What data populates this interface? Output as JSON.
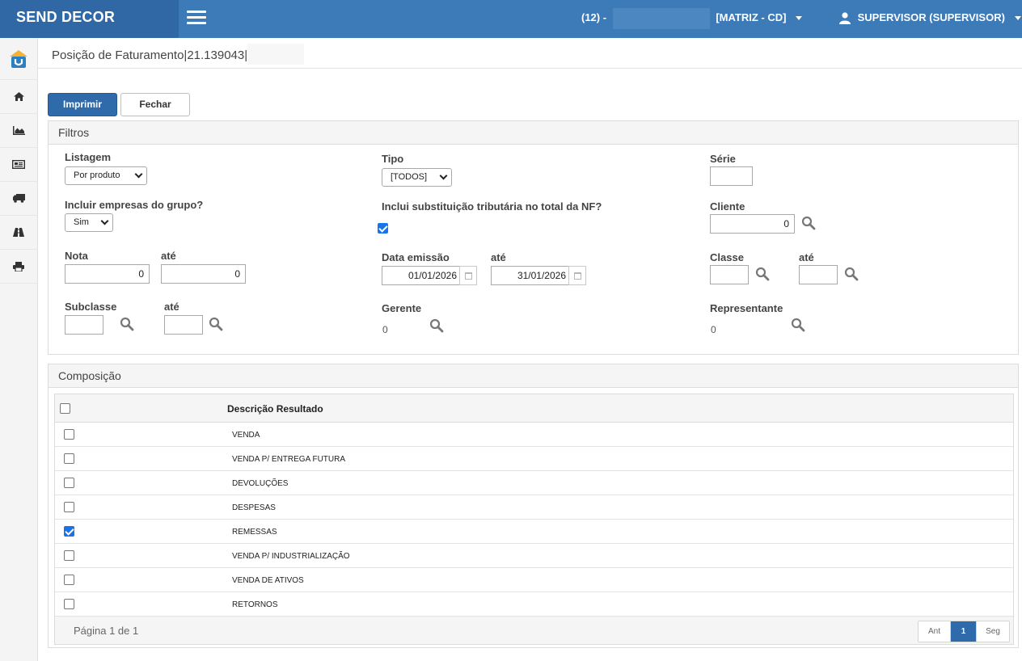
{
  "app": {
    "brand": "SEND DECOR"
  },
  "header": {
    "company_code": "(12) -",
    "company_branch": "[MATRIZ - CD]",
    "user": "SUPERVISOR (SUPERVISOR)"
  },
  "sidebar": {
    "items": [
      "home-icon",
      "area-chart-icon",
      "newspaper-icon",
      "truck-icon",
      "road-icon",
      "print-icon"
    ]
  },
  "page": {
    "title": "Posição de Faturamento|21.139043|"
  },
  "toolbar": {
    "print_label": "Imprimir",
    "close_label": "Fechar"
  },
  "filters": {
    "heading": "Filtros",
    "listagem": {
      "label": "Listagem",
      "value": "Por produto"
    },
    "tipo": {
      "label": "Tipo",
      "value": "[TODOS]"
    },
    "serie": {
      "label": "Série",
      "value": ""
    },
    "incluir_empresas": {
      "label": "Incluir empresas do grupo?",
      "value": "Sim"
    },
    "substituicao": {
      "label": "Inclui substituição tributária no total da NF?",
      "checked": true
    },
    "cliente": {
      "label": "Cliente",
      "value": "0"
    },
    "nota": {
      "label": "Nota",
      "value": "0"
    },
    "nota_ate": {
      "label": "até",
      "value": "0"
    },
    "data_emissao": {
      "label": "Data emissão",
      "value": "01/01/2026"
    },
    "data_ate": {
      "label": "até",
      "value": "31/01/2026"
    },
    "classe": {
      "label": "Classe",
      "value": ""
    },
    "classe_ate": {
      "label": "até",
      "value": ""
    },
    "subclasse": {
      "label": "Subclasse",
      "value": ""
    },
    "subclasse_ate": {
      "label": "até",
      "value": ""
    },
    "gerente": {
      "label": "Gerente",
      "value": "0"
    },
    "representante": {
      "label": "Representante",
      "value": "0"
    }
  },
  "composicao": {
    "heading": "Composição",
    "column": "Descrição Resultado",
    "rows": [
      {
        "label": "VENDA",
        "checked": false
      },
      {
        "label": "VENDA P/ ENTREGA FUTURA",
        "checked": false
      },
      {
        "label": "DEVOLUÇÕES",
        "checked": false
      },
      {
        "label": "DESPESAS",
        "checked": false
      },
      {
        "label": "REMESSAS",
        "checked": true
      },
      {
        "label": "VENDA P/ INDUSTRIALIZAÇÃO",
        "checked": false
      },
      {
        "label": "VENDA DE ATIVOS",
        "checked": false
      },
      {
        "label": "RETORNOS",
        "checked": false
      }
    ],
    "page_info": "Página 1 de 1",
    "pager": {
      "prev": "Ant",
      "current": "1",
      "next": "Seg"
    }
  }
}
